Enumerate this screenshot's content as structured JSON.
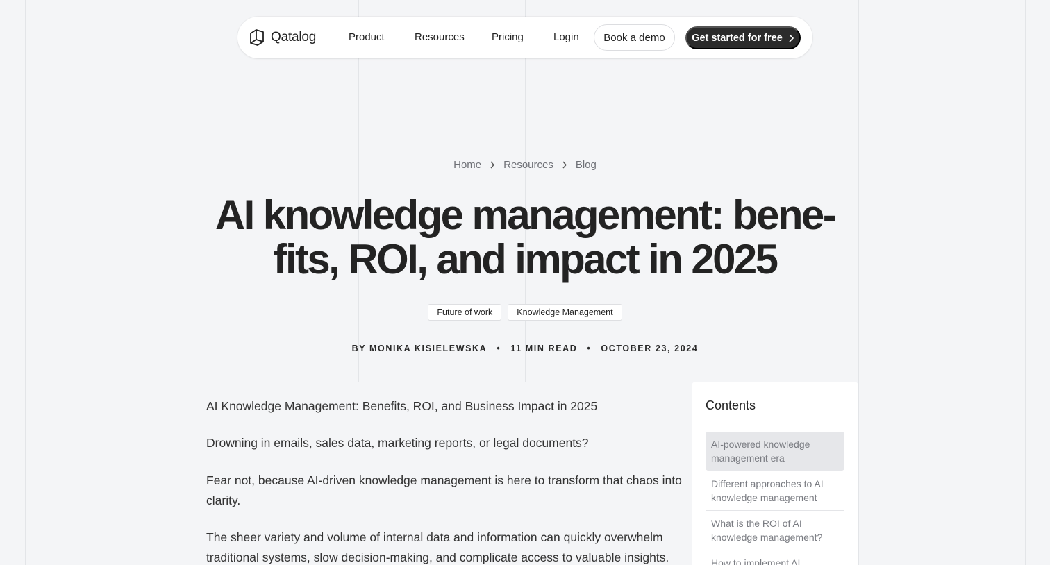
{
  "nav": {
    "logo_text": "Qatalog",
    "links": [
      "Product",
      "Resources",
      "Pricing",
      "Login"
    ],
    "book_demo": "Book a demo",
    "get_started": "Get started for free"
  },
  "breadcrumb": [
    "Home",
    "Resources",
    "Blog"
  ],
  "article": {
    "title_line1": "AI knowledge management: bene-",
    "title_line2": "fits, ROI, and impact in 2025",
    "tags": [
      "Future of work",
      "Knowledge Management"
    ],
    "author": "BY MONIKA KISIELEWSKA",
    "read_time": "11 MIN READ",
    "date": "OCTOBER 23, 2024",
    "meta_separator": "•",
    "paragraphs": [
      "AI Knowledge Management: Benefits, ROI, and Business Impact in 2025",
      "Drowning in emails, sales data, marketing reports, or legal documents?",
      "Fear not, because AI-driven knowledge management is here to transform that chaos into clarity.",
      "The sheer variety and volume of internal data and information can quickly overwhelm traditional systems, slow decision-making, and complicate access to valuable insights."
    ]
  },
  "toc": {
    "heading": "Contents",
    "items": [
      "AI-powered knowledge management era",
      "Different approaches to AI knowledge management",
      "What is the ROI of AI knowledge management?",
      "How to implement AI"
    ]
  }
}
